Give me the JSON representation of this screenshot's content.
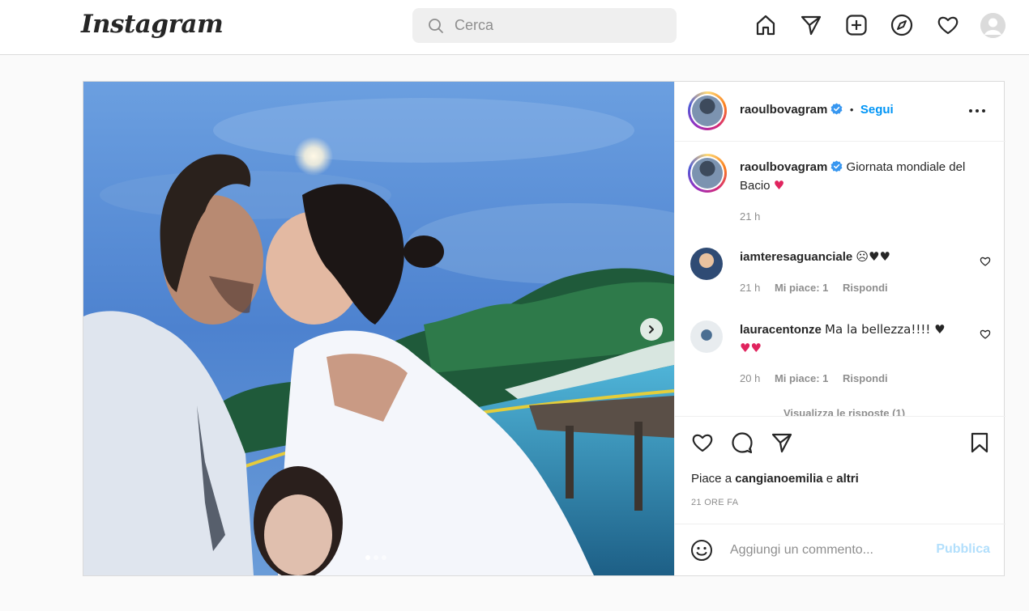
{
  "topbar": {
    "logo": "Instagram",
    "search_placeholder": "Cerca",
    "nav_icons": [
      "home-icon",
      "direct-icon",
      "new-post-icon",
      "explore-icon",
      "activity-icon",
      "profile-avatar"
    ]
  },
  "post": {
    "author": "raoulbovagram",
    "follow_label": "Segui",
    "separator": "•",
    "carousel": {
      "slide_count": 3,
      "active_slide": 1
    },
    "caption": {
      "username": "raoulbovagram",
      "text": "Giornata mondiale del Bacio",
      "emoji": "♥",
      "time": "21 h"
    },
    "comments": [
      {
        "username": "iamteresaguanciale",
        "text": "☹♥♥",
        "time": "21 h",
        "likes": "Mi piace: 1",
        "reply": "Rispondi"
      },
      {
        "username": "lauracentonze",
        "text": "Ma la bellezza!!!! ♥",
        "text_line2": "♥♥",
        "time": "20 h",
        "likes": "Mi piace: 1",
        "reply": "Rispondi"
      }
    ],
    "view_replies": "Visualizza le risposte (1)",
    "likes_prefix": "Piace a ",
    "likes_user": "cangianoemilia",
    "likes_suffix": " e ",
    "likes_others": "altri",
    "time_ago": "21 ORE FA",
    "add_comment_placeholder": "Aggiungi un commento...",
    "publish_label": "Pubblica"
  },
  "colors": {
    "accent": "#0095f6",
    "publish_disabled": "#b2dffc",
    "verified": "#3897f0",
    "heart_red": "#e0245e"
  }
}
